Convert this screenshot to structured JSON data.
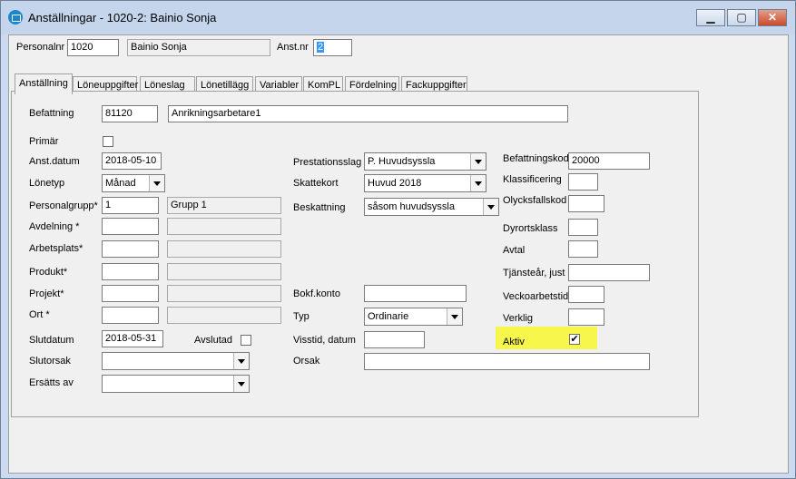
{
  "window": {
    "title": "Anställningar - 1020-2: Bainio Sonja",
    "minimize_glyph": "▁",
    "maximize_glyph": "▢",
    "close_glyph": "✕"
  },
  "header": {
    "personalnr_label": "Personalnr",
    "personalnr_value": "1020",
    "name_value": "Bainio Sonja",
    "anstnr_label": "Anst.nr",
    "anstnr_value": "2"
  },
  "tabs": [
    {
      "label": "Anställning"
    },
    {
      "label": "Löneuppgifter"
    },
    {
      "label": "Löneslag"
    },
    {
      "label": "Lönetillägg"
    },
    {
      "label": "Variabler"
    },
    {
      "label": "KomPL"
    },
    {
      "label": "Fördelning"
    },
    {
      "label": "Fackuppgifter"
    }
  ],
  "form": {
    "befattning_label": "Befattning",
    "befattning_code": "81120",
    "befattning_name": "Anrikningsarbetare1",
    "primar_label": "Primär",
    "anstdatum_label": "Anst.datum",
    "anstdatum_value": "2018-05-10",
    "lonetyp_label": "Lönetyp",
    "lonetyp_value": "Månad",
    "personalgrupp_label": "Personalgrupp*",
    "personalgrupp_code": "1",
    "personalgrupp_name": "Grupp 1",
    "avdelning_label": "Avdelning *",
    "arbetsplats_label": "Arbetsplats*",
    "produkt_label": "Produkt*",
    "projekt_label": "Projekt*",
    "ort_label": "Ort *",
    "slutdatum_label": "Slutdatum",
    "slutdatum_value": "2018-05-31",
    "avslutad_label": "Avslutad",
    "slutorsak_label": "Slutorsak",
    "ersatts_label": "Ersätts av",
    "prestationsslag_label": "Prestationsslag",
    "prestationsslag_value": "P. Huvudsyssla",
    "skattekort_label": "Skattekort",
    "skattekort_value": "Huvud 2018",
    "beskattning_label": "Beskattning",
    "beskattning_value": "såsom huvudsyssla",
    "bokfkonto_label": "Bokf.konto",
    "typ_label": "Typ",
    "typ_value": "Ordinarie",
    "visstid_label": "Visstid, datum",
    "orsak_label": "Orsak",
    "befattningskod_label": "Befattningskod",
    "befattningskod_value": "20000",
    "klassificering_label": "Klassificering",
    "olycksfallskod_label": "Olycksfallskod",
    "dyrortsklass_label": "Dyrortsklass",
    "avtal_label": "Avtal",
    "tjanstear_label": "Tjänsteår, just",
    "veckoarbetstid_label": "Veckoarbetstid",
    "verklig_label": "Verklig",
    "aktiv_label": "Aktiv",
    "check_glyph": "✔"
  },
  "colors": {
    "highlight": "#f6f64b",
    "selection": "#3399ff"
  }
}
